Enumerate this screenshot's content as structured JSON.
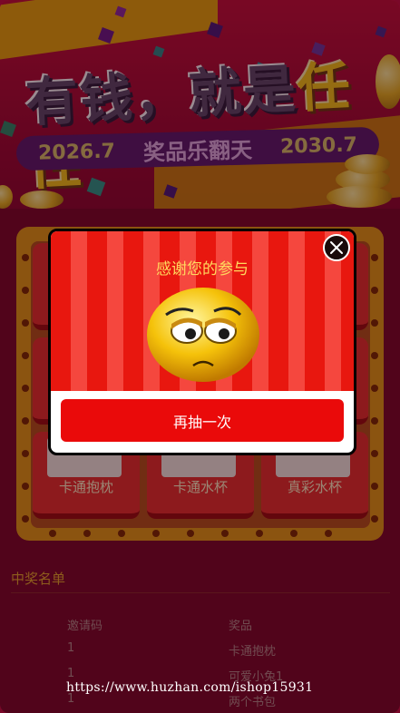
{
  "banner": {
    "headline_part1": "有钱，就是",
    "headline_part2": "任性",
    "date_start": "2026.7",
    "date_middle": "奖品乐翻天",
    "date_end": "2030.7"
  },
  "prizes": [
    {
      "label": "卡通抱枕"
    },
    {
      "label": "卡通水杯"
    },
    {
      "label": "真彩水杯"
    }
  ],
  "winners": {
    "title": "中奖名单",
    "columns": [
      "邀请码",
      "奖品"
    ],
    "rows": [
      {
        "code": "1",
        "prize": "卡通抱枕"
      },
      {
        "code": "1",
        "prize": "可爱小兔1"
      },
      {
        "code": "1",
        "prize": "两个书包"
      }
    ]
  },
  "modal": {
    "title": "感谢您的参与",
    "retry_label": "再抽一次",
    "close_icon": "close-icon",
    "face_icon": "disappointed-face-icon"
  },
  "watermark": "https://www.huzhan.com/ishop15931",
  "colors": {
    "accent_red": "#ea0a0a",
    "title_gold": "#ffd95e",
    "page_bg": "#7a0829"
  }
}
